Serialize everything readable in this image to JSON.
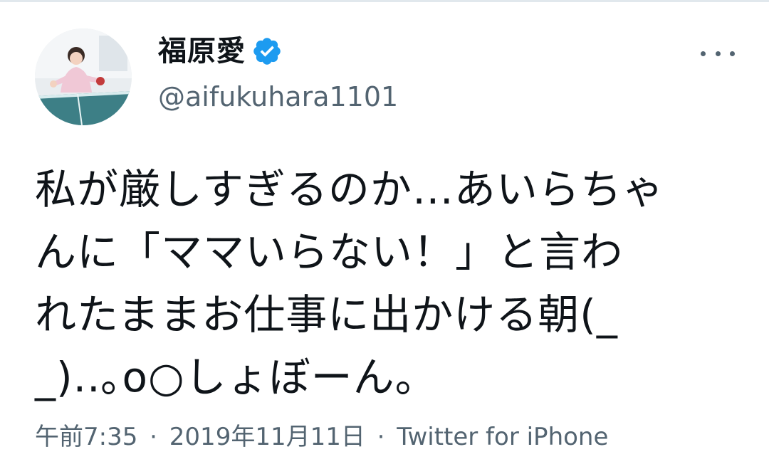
{
  "user": {
    "display_name": "福原愛",
    "handle": "@aifukuhara1101",
    "verified": true,
    "avatar_icon": "profile-photo-avatar"
  },
  "tweet": {
    "text": "私が厳しすぎるのか…あいらちゃ\nんに「ママいらない！」と言わ\nれたままお仕事に出かける朝(_\n_)..｡o○しょぼーん。"
  },
  "meta": {
    "time": "午前7:35",
    "separator": "·",
    "date": "2019年11月11日",
    "source": "Twitter for iPhone"
  },
  "colors": {
    "text": "#0f1419",
    "secondary": "#536471",
    "verified_badge": "#1d9bf0",
    "divider": "#e1e8ed"
  },
  "icons": {
    "verified": "verified-badge-icon",
    "more": "more-options-icon"
  }
}
